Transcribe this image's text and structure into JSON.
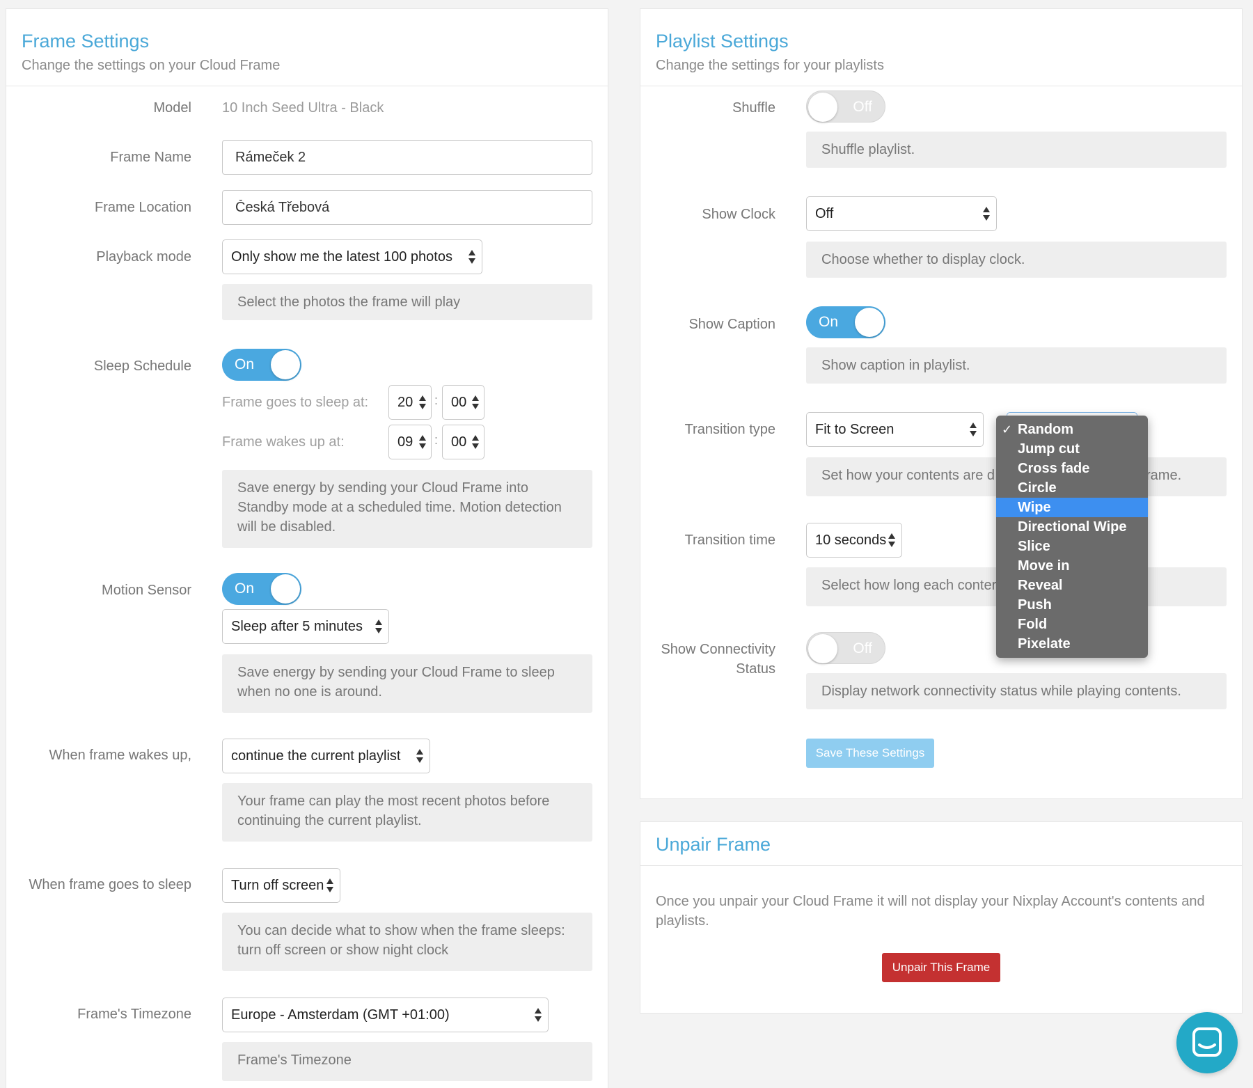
{
  "frame_settings": {
    "title": "Frame Settings",
    "subtitle": "Change the settings on your Cloud Frame",
    "model_label": "Model",
    "model_value": "10 Inch Seed Ultra - Black",
    "frame_name_label": "Frame Name",
    "frame_name_value": "Rámeček 2",
    "frame_location_label": "Frame Location",
    "frame_location_value": "Česká Třebová",
    "playback_mode_label": "Playback mode",
    "playback_mode_value": "Only show me the latest 100 photos",
    "playback_mode_help": "Select the photos the frame will play",
    "sleep_schedule_label": "Sleep Schedule",
    "sleep_schedule_toggle": "On",
    "sleep_at_label": "Frame goes to sleep at:",
    "sleep_at_hour": "20",
    "sleep_at_minute": "00",
    "wake_at_label": "Frame wakes up at:",
    "wake_at_hour": "09",
    "wake_at_minute": "00",
    "time_separator": ":",
    "sleep_schedule_help": "Save energy by sending your Cloud Frame into Standby mode at a scheduled time. Motion detection will be disabled.",
    "motion_sensor_label": "Motion Sensor",
    "motion_sensor_toggle": "On",
    "motion_sleep_value": "Sleep after 5 minutes",
    "motion_sensor_help": "Save energy by sending your Cloud Frame to sleep when no one is around.",
    "wakes_up_label": "When frame wakes up,",
    "wakes_up_value": "continue the current playlist",
    "wakes_up_help": "Your frame can play the most recent photos before continuing the current playlist.",
    "goes_sleep_label": "When frame goes to sleep",
    "goes_sleep_value": "Turn off screen",
    "goes_sleep_help": "You can decide what to show when the frame sleeps: turn off screen or show night clock",
    "timezone_label": "Frame's Timezone",
    "timezone_value": "Europe - Amsterdam (GMT +01:00)",
    "timezone_help": "Frame's Timezone"
  },
  "playlist_settings": {
    "title": "Playlist Settings",
    "subtitle": "Change the settings for your playlists",
    "shuffle_label": "Shuffle",
    "shuffle_toggle": "Off",
    "shuffle_help": "Shuffle playlist.",
    "show_clock_label": "Show Clock",
    "show_clock_value": "Off",
    "show_clock_help": "Choose whether to display clock.",
    "show_caption_label": "Show Caption",
    "show_caption_toggle": "On",
    "show_caption_help": "Show caption in playlist.",
    "transition_type_label": "Transition type",
    "transition_type_value": "Fit to Screen",
    "transition_type_help_left": "Set how your contents are d",
    "transition_type_help_right": "rame.",
    "transition_time_label": "Transition time",
    "transition_time_value": "10 seconds",
    "transition_time_help": "Select how long each conter",
    "connectivity_label_line1": "Show Connectivity",
    "connectivity_label_line2": "Status",
    "connectivity_toggle": "Off",
    "connectivity_help": "Display network connectivity status while playing contents.",
    "save_button": "Save These Settings"
  },
  "transition_dropdown": {
    "checked": "Random",
    "highlighted": "Wipe",
    "options": [
      "Random",
      "Jump cut",
      "Cross fade",
      "Circle",
      "Wipe",
      "Directional Wipe",
      "Slice",
      "Move in",
      "Reveal",
      "Push",
      "Fold",
      "Pixelate"
    ]
  },
  "unpair": {
    "title": "Unpair Frame",
    "description": "Once you unpair your Cloud Frame it will not display your Nixplay Account's contents and playlists.",
    "button": "Unpair This Frame"
  },
  "colors": {
    "accent": "#4aa8d8",
    "toggle_on": "#4aa8e0",
    "save_button": "#8fcdf0",
    "unpair_button": "#c43131",
    "dropdown_bg": "#6b6b6b",
    "dropdown_highlight": "#3d8ff0",
    "chat_button": "#23a9c7"
  },
  "icons": {
    "chat": "chat-bubble-icon",
    "select_arrows": "up-down-arrows-icon",
    "check": "checkmark-icon"
  }
}
